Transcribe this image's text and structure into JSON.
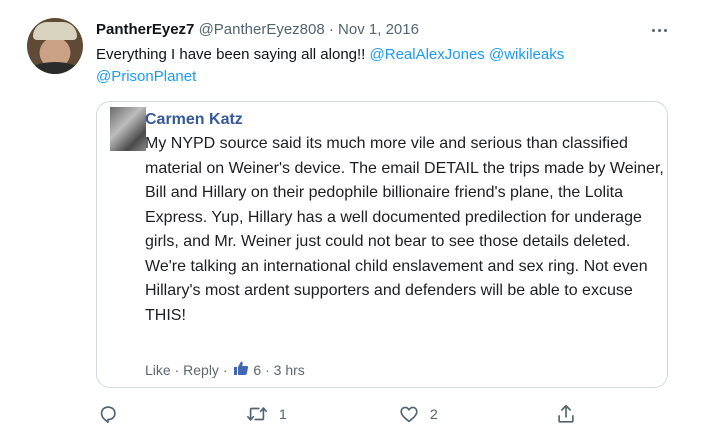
{
  "tweet": {
    "author_name": "PantherEyez7",
    "author_handle": "@PantherEyez808",
    "separator": "·",
    "date": "Nov 1, 2016",
    "text_prefix": "Everything I have been saying all along!! ",
    "mentions": [
      "@RealAlexJones",
      "@wikileaks",
      "@PrisonPlanet"
    ],
    "more_icon": "more-horizontal-icon"
  },
  "embedded_post": {
    "author": "Carmen Katz",
    "body": "My NYPD source said its much more vile and serious than classified material on Weiner's device. The email DETAIL the trips made by Weiner, Bill and Hillary on their pedophile billionaire friend's plane, the Lolita Express. Yup, Hillary has a well documented predilection for underage girls, and Mr. Weiner just could not bear to see those details deleted. We're talking an international child enslavement and sex ring. Not even Hillary's most ardent supporters and defenders will be able to excuse THIS!",
    "footer": {
      "like_label": "Like",
      "sep1": " · ",
      "reply_label": "Reply",
      "sep2": " · ",
      "like_count": "6",
      "sep3": " · ",
      "time": "3 hrs"
    }
  },
  "actions": {
    "reply_icon": "reply-icon",
    "retweet_icon": "retweet-icon",
    "retweet_count": "1",
    "like_icon": "heart-icon",
    "like_count": "2",
    "share_icon": "share-icon"
  },
  "colors": {
    "link": "#1d9bf0",
    "muted": "#536471",
    "facebook_name": "#365899",
    "border": "#cfd9de"
  }
}
